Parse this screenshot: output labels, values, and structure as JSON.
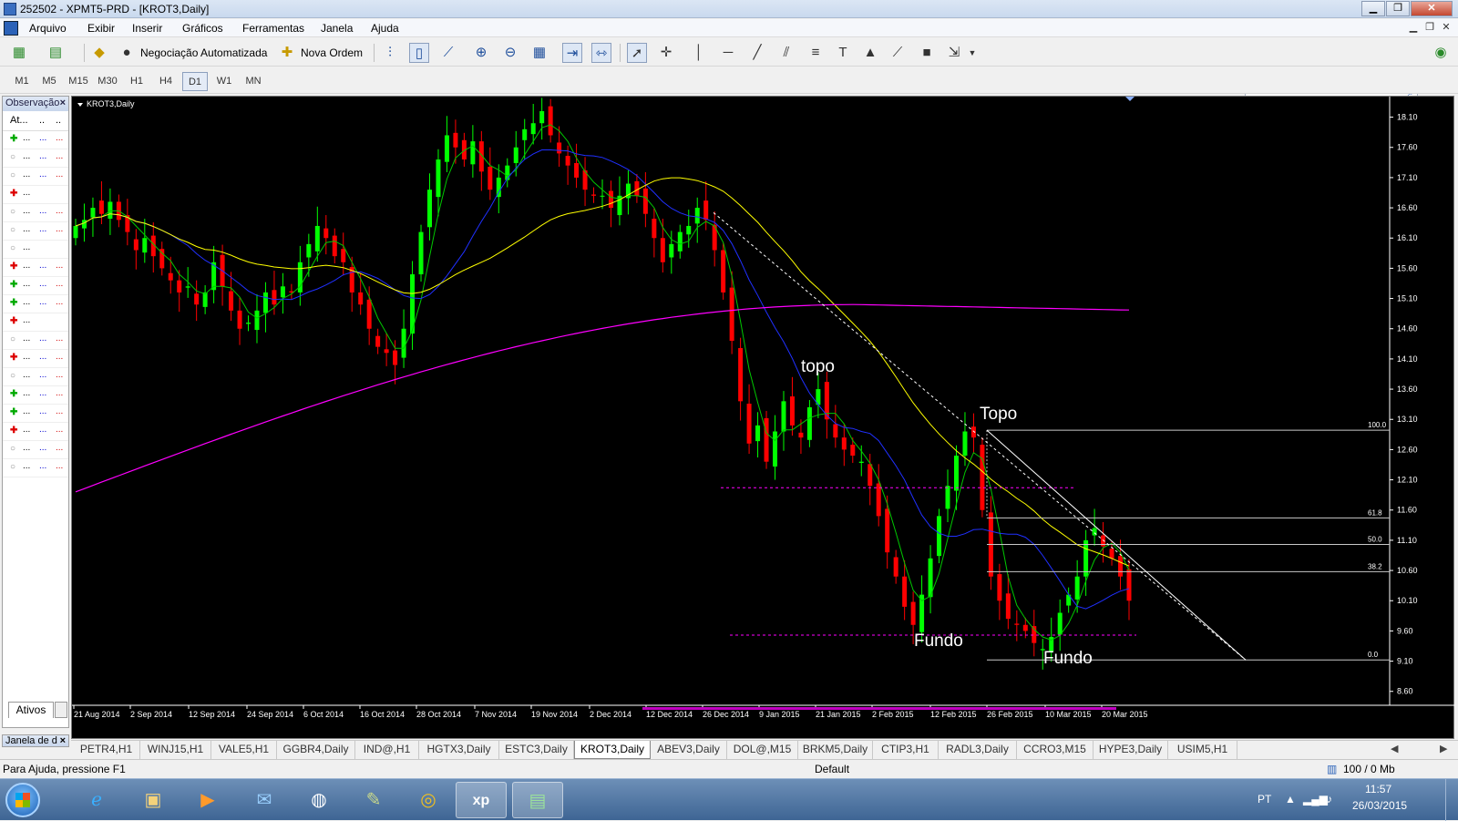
{
  "window": {
    "title": "252502 - XPMT5-PRD - [KROT3,Daily]"
  },
  "menu": [
    "Arquivo",
    "Exibir",
    "Inserir",
    "Gráficos",
    "Ferramentas",
    "Janela",
    "Ajuda"
  ],
  "toolbar": {
    "auto_trading_label": "Negociação Automatizada",
    "new_order_label": "Nova Ordem"
  },
  "timeframes": [
    "M1",
    "M5",
    "M15",
    "M30",
    "H1",
    "H4",
    "D1",
    "W1",
    "MN"
  ],
  "active_timeframe": "D1",
  "market_watch": {
    "title": "Observação",
    "column": "At...",
    "rows": [
      {
        "arrow": "up",
        "d1": "...",
        "d2": "...",
        "d3": "..."
      },
      {
        "arrow": "none",
        "d1": "...",
        "d2": "...",
        "d3": "..."
      },
      {
        "arrow": "none",
        "d1": "...",
        "d2": "...",
        "d3": "..."
      },
      {
        "arrow": "down",
        "d1": "...",
        "d2": "",
        "d3": ""
      },
      {
        "arrow": "none",
        "d1": "...",
        "d2": "...",
        "d3": "..."
      },
      {
        "arrow": "none",
        "d1": "...",
        "d2": "...",
        "d3": "..."
      },
      {
        "arrow": "none",
        "d1": "...",
        "d2": "",
        "d3": ""
      },
      {
        "arrow": "down",
        "d1": "...",
        "d2": "...",
        "d3": "..."
      },
      {
        "arrow": "up",
        "d1": "...",
        "d2": "...",
        "d3": "..."
      },
      {
        "arrow": "up",
        "d1": "...",
        "d2": "...",
        "d3": "..."
      },
      {
        "arrow": "down",
        "d1": "...",
        "d2": "",
        "d3": ""
      },
      {
        "arrow": "none",
        "d1": "...",
        "d2": "...",
        "d3": "..."
      },
      {
        "arrow": "down",
        "d1": "...",
        "d2": "...",
        "d3": "..."
      },
      {
        "arrow": "none",
        "d1": "...",
        "d2": "...",
        "d3": "..."
      },
      {
        "arrow": "up",
        "d1": "...",
        "d2": "...",
        "d3": "..."
      },
      {
        "arrow": "up",
        "d1": "...",
        "d2": "...",
        "d3": "..."
      },
      {
        "arrow": "down",
        "d1": "...",
        "d2": "...",
        "d3": "..."
      },
      {
        "arrow": "none",
        "d1": "...",
        "d2": "...",
        "d3": "..."
      },
      {
        "arrow": "none",
        "d1": "...",
        "d2": "...",
        "d3": "..."
      }
    ],
    "tab_label": "Ativos"
  },
  "data_window": {
    "title": "Janela de d"
  },
  "chart": {
    "label": "KROT3,Daily",
    "colors": {
      "bull": "#00ff00",
      "bear": "#ff0000",
      "ma_fast": "#00c800",
      "ma_mid": "#2030ff",
      "ma_slow": "#ffff00",
      "ma_long": "#ff00ff",
      "fibo": "#c8c8c8",
      "trend": "#ffffff"
    }
  },
  "chart_data": {
    "type": "candlestick",
    "price_ticks": [
      "18.10",
      "17.60",
      "17.10",
      "16.60",
      "16.10",
      "15.60",
      "15.10",
      "14.60",
      "14.10",
      "13.60",
      "13.10",
      "12.60",
      "12.10",
      "11.60",
      "11.10",
      "10.60",
      "10.10",
      "9.60",
      "9.10",
      "8.60"
    ],
    "date_ticks": [
      "21 Aug 2014",
      "2 Sep 2014",
      "12 Sep 2014",
      "24 Sep 2014",
      "6 Oct 2014",
      "16 Oct 2014",
      "28 Oct 2014",
      "7 Nov 2014",
      "19 Nov 2014",
      "2 Dec 2014",
      "12 Dec 2014",
      "26 Dec 2014",
      "9 Jan 2015",
      "21 Jan 2015",
      "2 Feb 2015",
      "12 Feb 2015",
      "26 Feb 2015",
      "10 Mar 2015",
      "20 Mar 2015"
    ],
    "fibo_levels": [
      {
        "label": "100.0",
        "price": 12.92
      },
      {
        "label": "61.8",
        "price": 11.47
      },
      {
        "label": "50.0",
        "price": 11.03
      },
      {
        "label": "38.2",
        "price": 10.58
      },
      {
        "label": "0.0",
        "price": 9.12
      }
    ],
    "support_levels": [
      11.97,
      9.53
    ],
    "annotations": [
      "topo",
      "Topo",
      "Fundo",
      "Fundo"
    ],
    "trendline": {
      "from": {
        "date": "26 Dec 2014",
        "price": 16.52
      },
      "to": {
        "date": "10 Apr 2015",
        "price": 9.12
      }
    },
    "closes": [
      16.3,
      16.4,
      16.6,
      16.5,
      16.7,
      16.4,
      16.2,
      15.9,
      16.1,
      15.8,
      15.6,
      15.4,
      15.2,
      15.3,
      15.0,
      15.2,
      15.7,
      15.3,
      14.9,
      14.6,
      14.7,
      14.9,
      15.2,
      15.0,
      15.3,
      15.2,
      15.7,
      16.0,
      16.3,
      16.1,
      15.8,
      15.7,
      15.2,
      15.0,
      14.6,
      14.3,
      14.2,
      14.0,
      14.6,
      15.5,
      16.2,
      16.9,
      17.4,
      17.8,
      17.6,
      17.4,
      17.7,
      17.2,
      16.9,
      17.1,
      17.3,
      17.6,
      17.9,
      18.0,
      18.2,
      17.8,
      17.5,
      17.3,
      17.1,
      16.9,
      16.8,
      16.8,
      16.6,
      16.8,
      17.0,
      16.8,
      16.5,
      16.1,
      15.7,
      16.0,
      16.2,
      16.3,
      16.6,
      16.4,
      15.9,
      15.2,
      14.4,
      13.4,
      12.7,
      13.0,
      12.4,
      12.9,
      13.4,
      13.0,
      12.8,
      13.3,
      13.6,
      13.1,
      12.8,
      12.6,
      12.5,
      12.4,
      12.0,
      11.5,
      10.9,
      10.5,
      10.0,
      9.7,
      10.2,
      10.8,
      11.5,
      12.0,
      12.5,
      12.9,
      12.8,
      11.6,
      10.5,
      10.1,
      9.8,
      9.7,
      9.6,
      9.4,
      9.3,
      9.5,
      9.9,
      10.2,
      10.5,
      11.1,
      11.3,
      11.0,
      10.8,
      10.5,
      10.1
    ]
  },
  "chart_tabs": [
    "PETR4,H1",
    "WINJ15,H1",
    "VALE5,H1",
    "GGBR4,Daily",
    "IND@,H1",
    "HGTX3,Daily",
    "ESTC3,Daily",
    "KROT3,Daily",
    "ABEV3,Daily",
    "DOL@,M15",
    "BRKM5,Daily",
    "CTIP3,H1",
    "RADL3,Daily",
    "CCRO3,M15",
    "HYPE3,Daily",
    "USIM5,H1"
  ],
  "active_chart_tab": "KROT3,Daily",
  "status": {
    "help": "Para Ajuda, pressione F1",
    "profile": "Default",
    "traffic": "100 / 0 Mb"
  },
  "taskbar": {
    "lang": "PT",
    "time": "11:57",
    "date": "26/03/2015"
  }
}
